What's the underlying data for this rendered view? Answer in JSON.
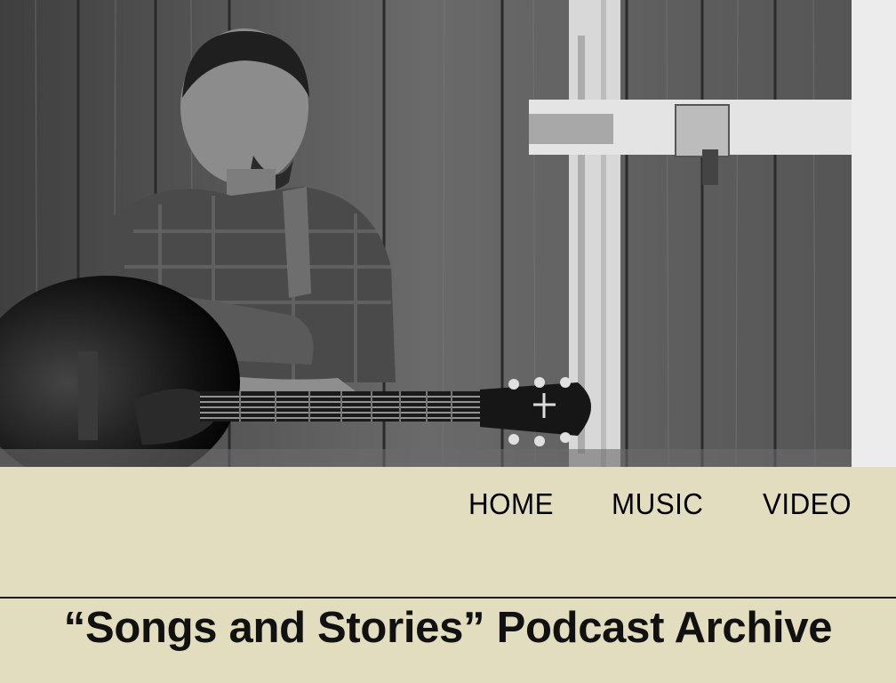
{
  "hero": {
    "alt": "Black-and-white photo of a man with a guitar leaning against a barn door"
  },
  "nav": {
    "items": [
      {
        "label": "HOME"
      },
      {
        "label": "MUSIC"
      },
      {
        "label": "VIDEO"
      }
    ]
  },
  "page": {
    "title": "“Songs and Stories” Podcast Archive"
  },
  "colors": {
    "page_background": "#e3ddbf",
    "text": "#000000",
    "rule": "#1a1a1a",
    "side_strip": "#ececec"
  }
}
